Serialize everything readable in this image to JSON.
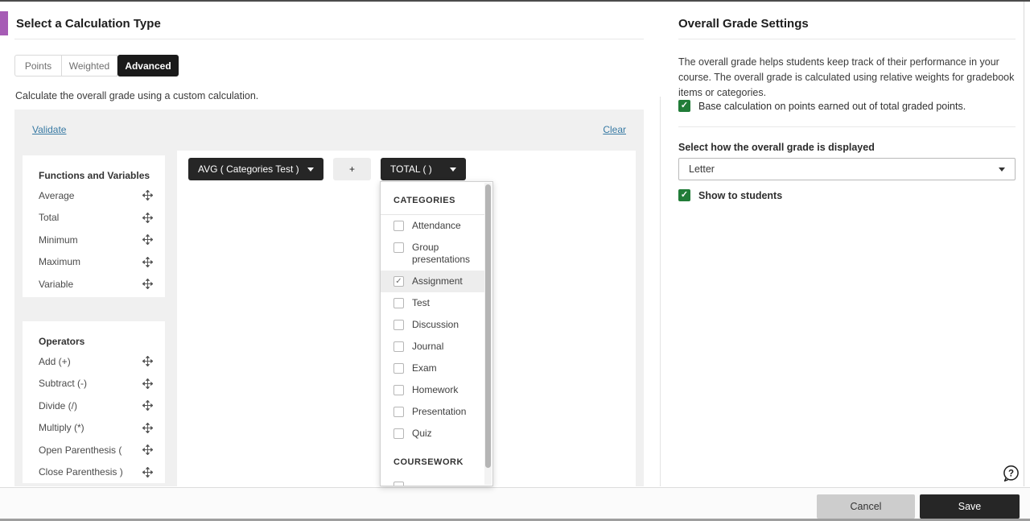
{
  "colors": {
    "accent": "#a65cb5",
    "green_check": "#217c38",
    "link_blue": "#3779a3",
    "chip_dark": "#262626"
  },
  "icons": {
    "move": "move-icon",
    "chevron": "chevron-down-icon",
    "checkbox_checked": "checkbox-checked-icon",
    "help": "help-bubble-icon",
    "scrollbar": "scrollbar-thumb"
  },
  "left": {
    "title": "Select a Calculation Type",
    "tabs": {
      "points": "Points",
      "weighted": "Weighted",
      "advanced": "Advanced",
      "active": "Advanced"
    },
    "description": "Calculate the overall grade using a custom calculation.",
    "calc": {
      "validate": "Validate",
      "clear": "Clear",
      "functions": {
        "title": "Functions and Variables",
        "items": [
          "Average",
          "Total",
          "Minimum",
          "Maximum",
          "Variable"
        ]
      },
      "operators": {
        "title": "Operators",
        "items": [
          "Add (+)",
          "Subtract (-)",
          "Divide (/)",
          "Multiply (*)",
          "Open Parenthesis (",
          "Close Parenthesis )"
        ]
      },
      "chips": {
        "avg": "AVG ( Categories Test )",
        "plus": "+",
        "total": "TOTAL ( )"
      },
      "dropdown": {
        "categories_header": "CATEGORIES",
        "categories": [
          {
            "label": "Attendance",
            "checked": false
          },
          {
            "label": "Group presentations",
            "checked": false
          },
          {
            "label": "Assignment",
            "checked": true
          },
          {
            "label": "Test",
            "checked": false
          },
          {
            "label": "Discussion",
            "checked": false
          },
          {
            "label": "Journal",
            "checked": false
          },
          {
            "label": "Exam",
            "checked": false
          },
          {
            "label": "Homework",
            "checked": false
          },
          {
            "label": "Presentation",
            "checked": false
          },
          {
            "label": "Quiz",
            "checked": false
          }
        ],
        "coursework_header": "COURSEWORK"
      }
    }
  },
  "right": {
    "title": "Overall Grade Settings",
    "description": "The overall grade helps students keep track of their performance in your course. The overall grade is calculated using relative weights for gradebook items or categories.",
    "base_checkbox": {
      "label": "Base calculation on points earned out of total graded points.",
      "checked": true
    },
    "display": {
      "label": "Select how the overall grade is displayed",
      "value": "Letter"
    },
    "show_checkbox": {
      "label": "Show to students",
      "checked": true
    }
  },
  "footer": {
    "cancel": "Cancel",
    "save": "Save"
  }
}
